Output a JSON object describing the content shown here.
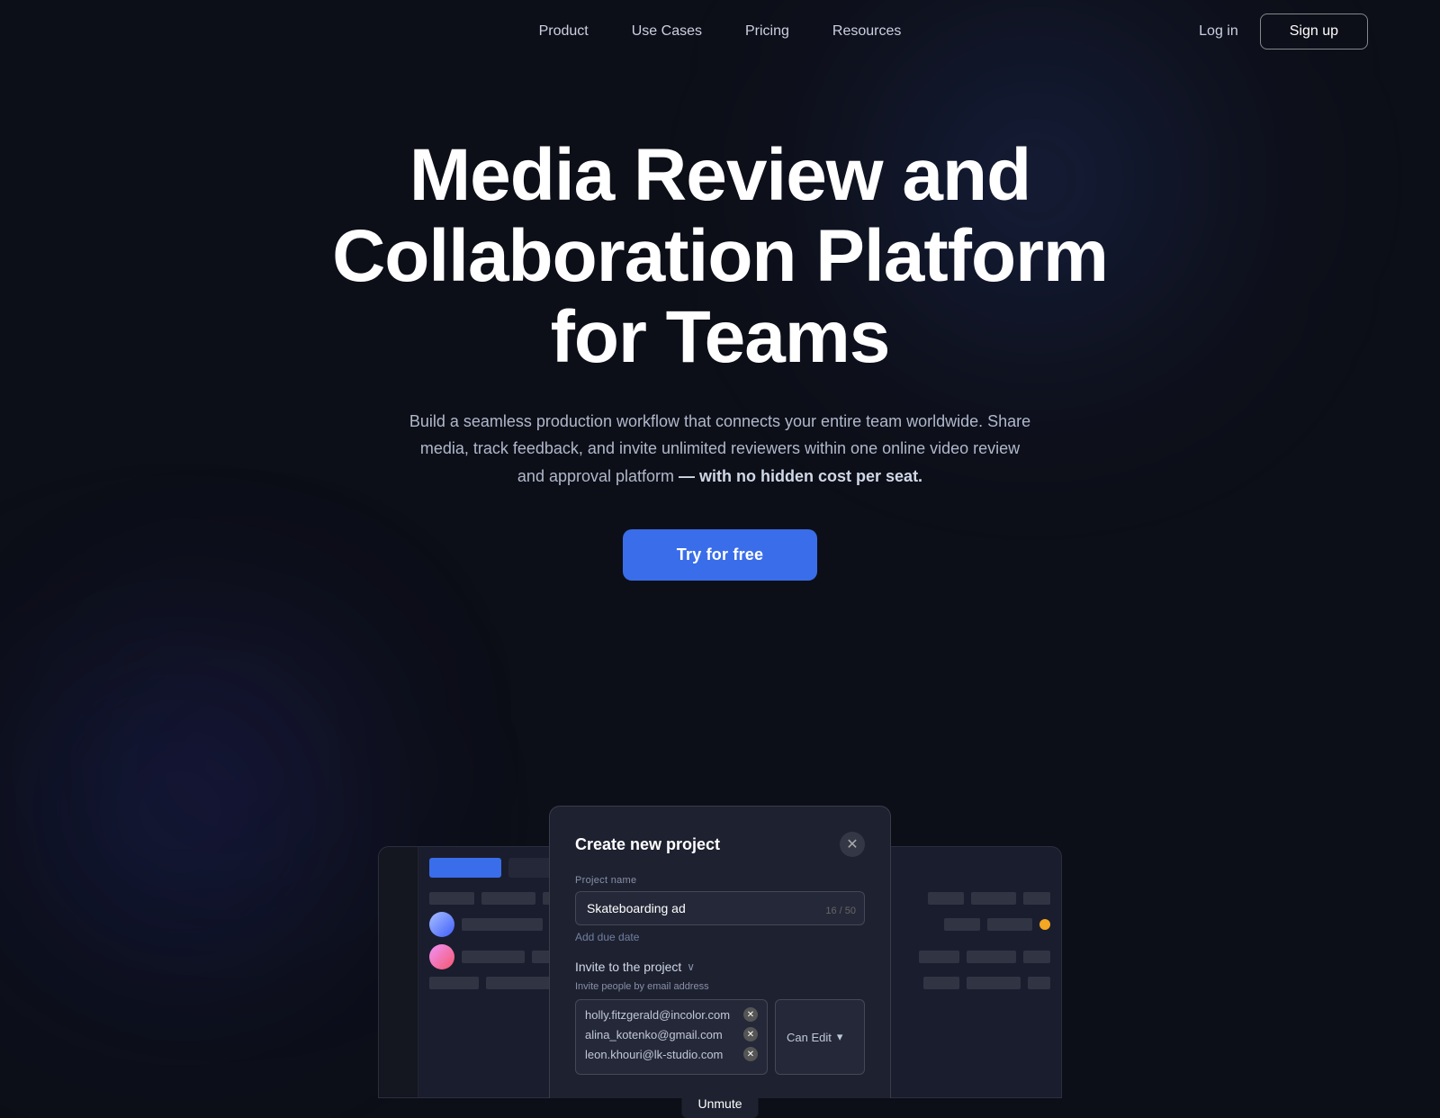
{
  "nav": {
    "links": [
      {
        "label": "Product",
        "id": "product"
      },
      {
        "label": "Use Cases",
        "id": "use-cases"
      },
      {
        "label": "Pricing",
        "id": "pricing"
      },
      {
        "label": "Resources",
        "id": "resources"
      }
    ],
    "login_label": "Log in",
    "signup_label": "Sign up"
  },
  "hero": {
    "title": "Media Review and Collaboration Platform for Teams",
    "subtitle": "Build a seamless production workflow that connects your entire team worldwide. Share media, track feedback, and invite unlimited reviewers within one online video review and approval platform ",
    "subtitle_bold": "— with no hidden cost per seat.",
    "cta_label": "Try for free"
  },
  "unmute": {
    "label": "Unmute"
  },
  "modal": {
    "title": "Create new project",
    "project_name_label": "Project name",
    "project_name_value": "Skateboarding ad",
    "char_count": "16 / 50",
    "add_date_label": "Add due date",
    "invite_section_title": "Invite to the project",
    "invite_chevron": "∨",
    "invite_sublabel": "Invite people by email address",
    "emails": [
      {
        "address": "holly.fitzgerald@incolor.com"
      },
      {
        "address": "alina_kotenko@gmail.com"
      },
      {
        "address": "leon.khouri@lk-studio.com"
      }
    ],
    "permission_label": "Can Edit",
    "close_icon": "✕"
  },
  "colors": {
    "accent_blue": "#3a6dea",
    "bg_dark": "#0d0f18",
    "modal_bg": "#1e2130",
    "nav_bg": "transparent"
  }
}
